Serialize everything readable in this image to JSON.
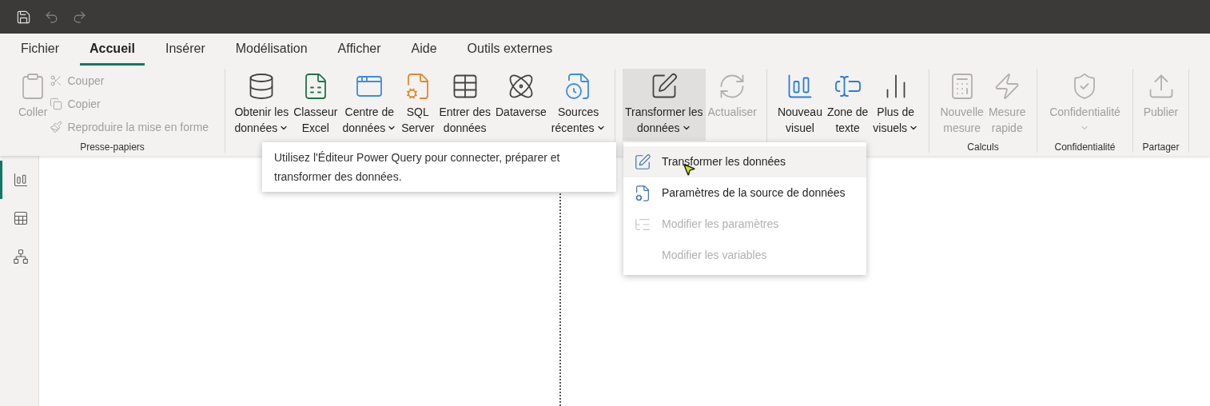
{
  "tabs": [
    {
      "label": "Fichier",
      "selected": false
    },
    {
      "label": "Accueil",
      "selected": true
    },
    {
      "label": "Insérer",
      "selected": false
    },
    {
      "label": "Modélisation",
      "selected": false
    },
    {
      "label": "Afficher",
      "selected": false
    },
    {
      "label": "Aide",
      "selected": false
    },
    {
      "label": "Outils externes",
      "selected": false
    }
  ],
  "ribbon": {
    "groups": [
      {
        "label": "Presse-papiers",
        "items": [
          {
            "kind": "large",
            "lines": [
              "Coller"
            ],
            "disabled": true,
            "dropdown": false,
            "pressed": false
          },
          {
            "kind": "stack",
            "items": [
              {
                "label": "Couper",
                "disabled": true
              },
              {
                "label": "Copier",
                "disabled": true
              },
              {
                "label": "Reproduire la mise en forme",
                "disabled": true
              }
            ]
          }
        ]
      },
      {
        "items": [
          {
            "kind": "large",
            "lines": [
              "Obtenir les",
              "données"
            ],
            "disabled": false,
            "dropdown": true,
            "pressed": false
          },
          {
            "kind": "large",
            "lines": [
              "Classeur",
              "Excel"
            ],
            "disabled": false,
            "dropdown": false,
            "pressed": false
          },
          {
            "kind": "large",
            "lines": [
              "Centre de",
              "données"
            ],
            "disabled": false,
            "dropdown": true,
            "pressed": false
          },
          {
            "kind": "large",
            "lines": [
              "SQL",
              "Server"
            ],
            "disabled": false,
            "dropdown": false,
            "pressed": false
          },
          {
            "kind": "large",
            "lines": [
              "Entrer des",
              "données"
            ],
            "disabled": false,
            "dropdown": false,
            "pressed": false
          },
          {
            "kind": "large",
            "lines": [
              "Dataverse"
            ],
            "disabled": false,
            "dropdown": false,
            "pressed": false
          },
          {
            "kind": "large",
            "lines": [
              "Sources",
              "récentes"
            ],
            "disabled": false,
            "dropdown": true,
            "pressed": false
          }
        ]
      },
      {
        "items": [
          {
            "kind": "large",
            "lines": [
              "Transformer les",
              "données"
            ],
            "disabled": false,
            "dropdown": true,
            "pressed": true
          },
          {
            "kind": "large",
            "lines": [
              "Actualiser"
            ],
            "disabled": true,
            "dropdown": false,
            "pressed": false
          }
        ]
      },
      {
        "items": [
          {
            "kind": "large",
            "lines": [
              "Nouveau",
              "visuel"
            ],
            "disabled": false,
            "dropdown": false,
            "pressed": false
          },
          {
            "kind": "large",
            "lines": [
              "Zone de",
              "texte"
            ],
            "disabled": false,
            "dropdown": false,
            "pressed": false
          },
          {
            "kind": "large",
            "lines": [
              "Plus de",
              "visuels"
            ],
            "disabled": false,
            "dropdown": true,
            "pressed": false
          }
        ]
      },
      {
        "label": "Calculs",
        "items": [
          {
            "kind": "large",
            "lines": [
              "Nouvelle",
              "mesure"
            ],
            "disabled": true,
            "dropdown": false,
            "pressed": false
          },
          {
            "kind": "large",
            "lines": [
              "Mesure",
              "rapide"
            ],
            "disabled": true,
            "dropdown": false,
            "pressed": false
          }
        ]
      },
      {
        "label": "Confidentialité",
        "items": [
          {
            "kind": "large",
            "lines": [
              "Confidentialité"
            ],
            "disabled": true,
            "dropdown": true,
            "pressed": false
          }
        ]
      },
      {
        "label": "Partager",
        "items": [
          {
            "kind": "large",
            "lines": [
              "Publier"
            ],
            "disabled": true,
            "dropdown": false,
            "pressed": false
          }
        ]
      }
    ]
  },
  "sidebar": {
    "items": [
      {
        "selected": true
      },
      {
        "selected": false
      },
      {
        "selected": false
      }
    ]
  },
  "tooltip": "Utilisez l'Éditeur Power Query pour connecter, préparer et transformer des données.",
  "menu": {
    "items": [
      {
        "label": "Transformer les données",
        "selected": true,
        "disabled": false
      },
      {
        "label": "Paramètres de la source de données",
        "selected": false,
        "disabled": false
      },
      {
        "label": "Modifier les paramètres",
        "selected": false,
        "disabled": true
      },
      {
        "label": "Modifier les variables",
        "selected": false,
        "disabled": true
      }
    ]
  }
}
